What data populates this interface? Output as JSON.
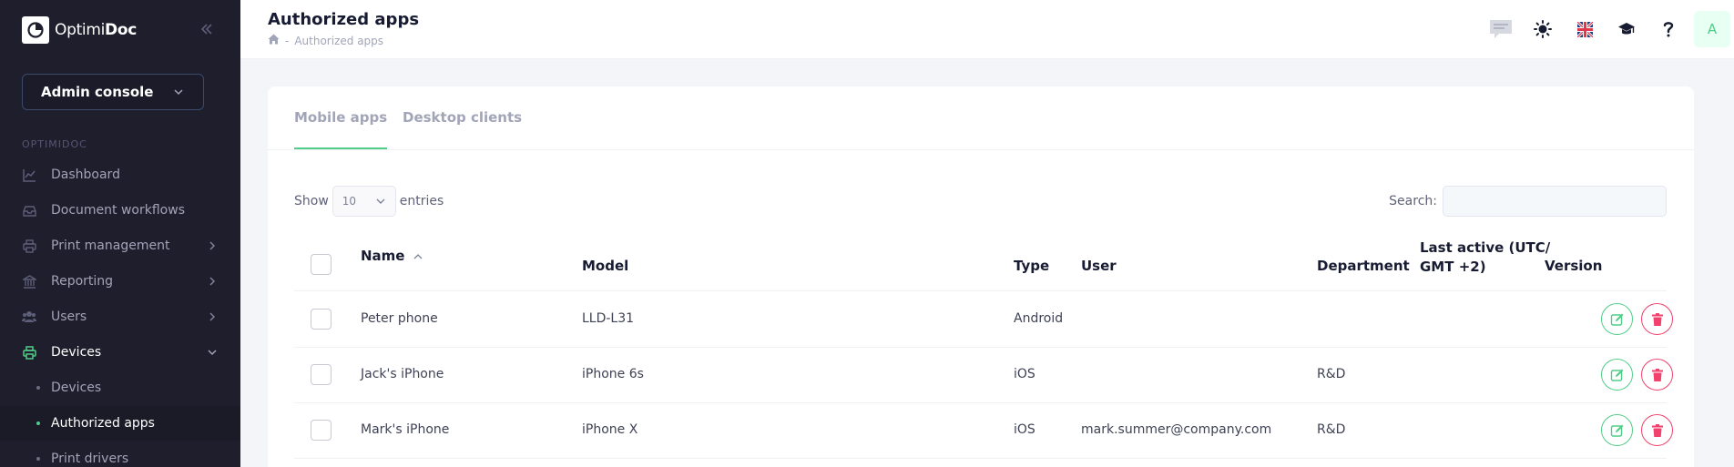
{
  "brand": {
    "name_light": "Optimi",
    "name_bold": "Doc"
  },
  "sidebar": {
    "console_label": "Admin console",
    "section": "OPTIMIDOC",
    "items": [
      {
        "label": "Dashboard",
        "icon": "chart-line-icon",
        "has_arrow": false
      },
      {
        "label": "Document workflows",
        "icon": "inbox-icon",
        "has_arrow": false
      },
      {
        "label": "Print management",
        "icon": "printer-icon",
        "has_arrow": true
      },
      {
        "label": "Reporting",
        "icon": "bank-icon",
        "has_arrow": true
      },
      {
        "label": "Users",
        "icon": "users-icon",
        "has_arrow": true
      },
      {
        "label": "Devices",
        "icon": "printer-icon",
        "has_arrow": true,
        "expanded": true
      }
    ],
    "sub_items": [
      {
        "label": "Devices",
        "active": false
      },
      {
        "label": "Authorized apps",
        "active": true
      },
      {
        "label": "Print drivers",
        "active": false
      }
    ]
  },
  "header": {
    "title": "Authorized apps",
    "breadcrumb_sep": "-",
    "breadcrumb_current": "Authorized apps",
    "toolbar_icons": [
      "chat-icon",
      "sun-icon",
      "uk-flag-icon",
      "graduation-cap-icon",
      "question-icon"
    ],
    "avatar_letter": "A"
  },
  "tabs": [
    "Mobile apps",
    "Desktop clients"
  ],
  "table_controls": {
    "show_label": "Show",
    "entries_value": "10",
    "entries_label": "entries",
    "search_label": "Search:"
  },
  "table": {
    "columns": {
      "name": "Name",
      "model": "Model",
      "type": "Type",
      "user": "User",
      "department": "Department",
      "last_active_1": "Last active (UTC/",
      "last_active_2": "GMT +2)",
      "version": "Version"
    },
    "rows": [
      {
        "name": "Peter phone",
        "model": "LLD-L31",
        "type": "Android",
        "user": "",
        "department": "",
        "last_active": "",
        "version": ""
      },
      {
        "name": "Jack's iPhone",
        "model": "iPhone 6s",
        "type": "iOS",
        "user": "",
        "department": "R&D",
        "last_active": "",
        "version": ""
      },
      {
        "name": "Mark's iPhone",
        "model": "iPhone X",
        "type": "iOS",
        "user": "mark.summer@company.com",
        "department": "R&D",
        "last_active": "",
        "version": ""
      }
    ]
  },
  "colors": {
    "accent": "#50cd89",
    "danger": "#f1416c",
    "sidebar_bg": "#1e1e2d"
  }
}
